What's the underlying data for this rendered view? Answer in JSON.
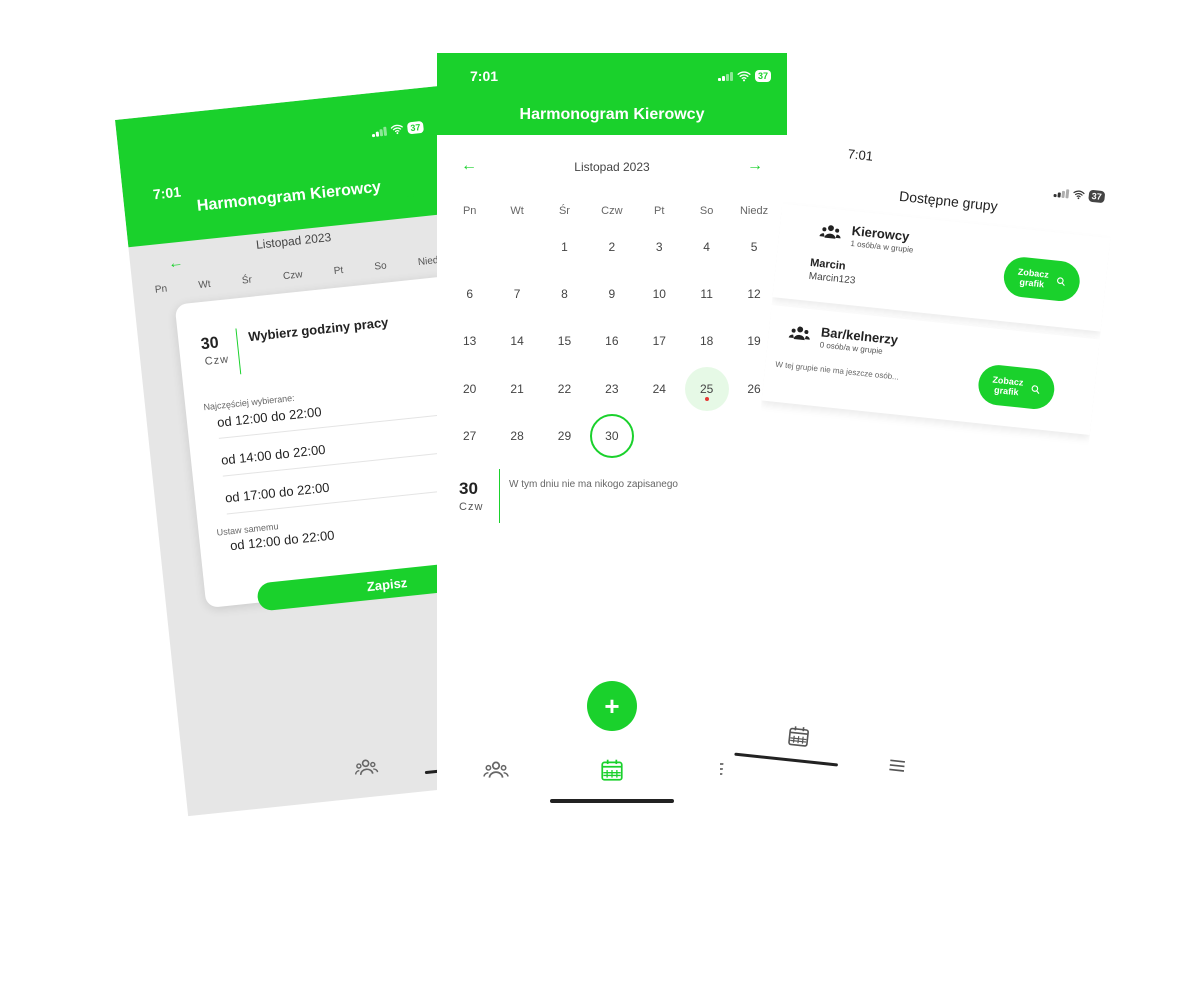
{
  "colors": {
    "accent": "#1ad12c",
    "today_dot": "#e53935"
  },
  "status_bar": {
    "time": "7:01",
    "battery": "37"
  },
  "header": {
    "title": "Harmonogram Kierowcy"
  },
  "calendar": {
    "month_label": "Listopad 2023",
    "weekdays": [
      "Pn",
      "Wt",
      "Śr",
      "Czw",
      "Pt",
      "So",
      "Niedz"
    ],
    "leading_empty_days": 2,
    "days": [
      "1",
      "2",
      "3",
      "4",
      "5",
      "6",
      "7",
      "8",
      "9",
      "10",
      "11",
      "12",
      "13",
      "14",
      "15",
      "16",
      "17",
      "18",
      "19",
      "20",
      "21",
      "22",
      "23",
      "24",
      "25",
      "26",
      "27",
      "28",
      "29",
      "30"
    ],
    "today": "25",
    "selected": "30"
  },
  "selected_day": {
    "number": "30",
    "weekday": "Czw",
    "empty_message": "W tym dniu nie ma nikogo zapisanego"
  },
  "fab": {
    "label": "+"
  },
  "hours_modal": {
    "day_number": "30",
    "day_name": "Czw",
    "title": "Wybierz godziny pracy",
    "frequent_label": "Najczęściej wybierane:",
    "options": [
      "od 12:00 do 22:00",
      "od 14:00 do 22:00",
      "od 17:00 do 22:00"
    ],
    "custom_label": "Ustaw samemu",
    "custom_value": "od 12:00 do 22:00",
    "save_label": "Zapisz"
  },
  "groups_screen": {
    "title": "Dostępne grupy",
    "groups": [
      {
        "name": "Kierowcy",
        "count": "1 osób/a w grupie",
        "member_name": "Marcin",
        "member_login": "Marcin123",
        "button_label": "Zobacz grafik"
      },
      {
        "name": "Bar/kelnerzy",
        "count": "0 osób/a w grupie",
        "empty": "W tej grupie nie ma jeszcze osób...",
        "button_label": "Zobacz grafik"
      }
    ]
  },
  "icons": {
    "nav_groups": "people-icon",
    "nav_calendar": "calendar-icon",
    "nav_menu": "menu-icon",
    "prev": "arrow-left-icon",
    "next": "arrow-right-icon",
    "search": "search-icon"
  }
}
